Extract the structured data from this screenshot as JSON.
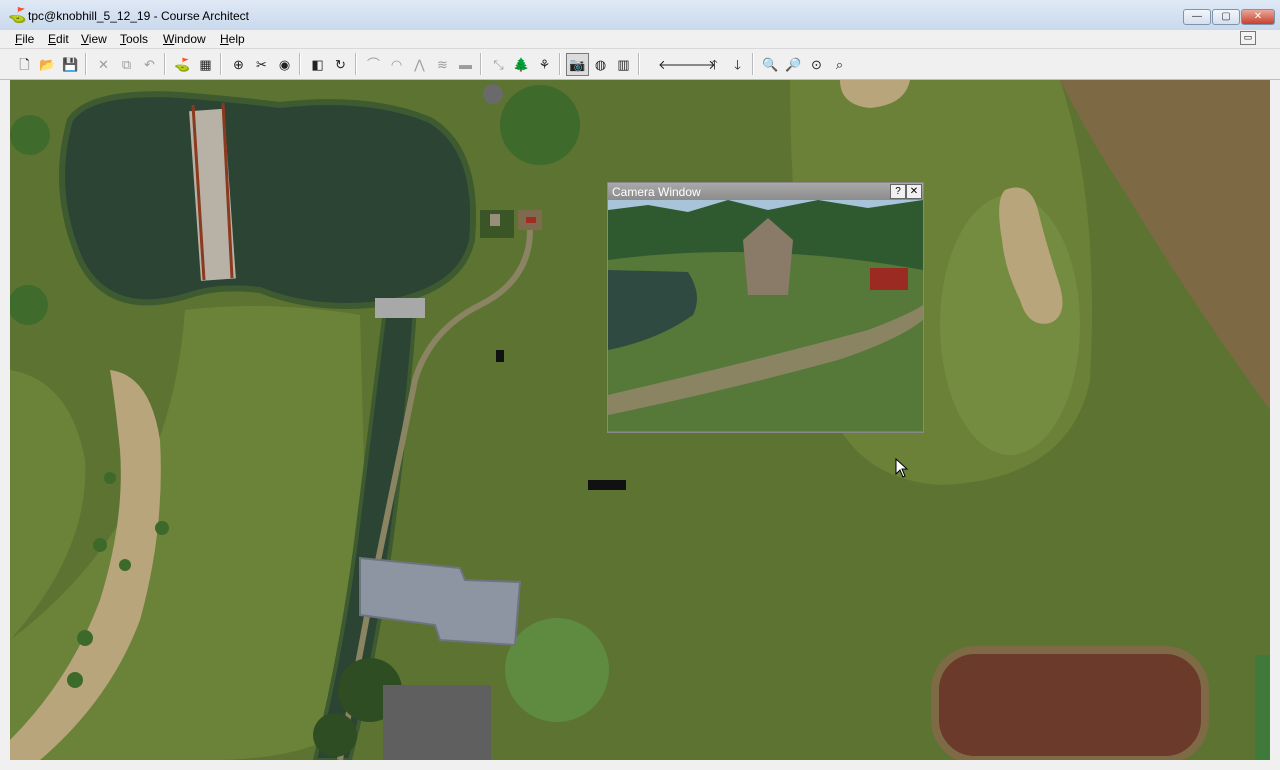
{
  "window": {
    "title": "tpc@knobhill_5_12_19 - Course Architect",
    "min_glyph": "—",
    "max_glyph": "▢",
    "close_glyph": "✕",
    "app_icon": "golf-flag-icon"
  },
  "menu": {
    "items": [
      "File",
      "Edit",
      "View",
      "Tools",
      "Window",
      "Help"
    ],
    "mdi_restore_glyph": "▭"
  },
  "toolbar": {
    "groups": [
      [
        {
          "icon": "new-file-icon",
          "glyph": "🗋"
        },
        {
          "icon": "open-folder-icon",
          "glyph": "📂"
        },
        {
          "icon": "save-icon",
          "glyph": "💾"
        }
      ],
      [
        {
          "icon": "delete-icon",
          "glyph": "✕",
          "dim": true
        },
        {
          "icon": "group-icon",
          "glyph": "⧉",
          "dim": true
        },
        {
          "icon": "undo-icon",
          "glyph": "↶",
          "dim": true
        }
      ],
      [
        {
          "icon": "hole-layout-icon",
          "glyph": "⛳",
          "dim": true
        },
        {
          "icon": "grid-icon",
          "glyph": "▦"
        }
      ],
      [
        {
          "icon": "select-target-icon",
          "glyph": "⊕"
        },
        {
          "icon": "spline-tool-icon",
          "glyph": "✂"
        },
        {
          "icon": "compass-icon",
          "glyph": "◉"
        }
      ],
      [
        {
          "icon": "measure-icon",
          "glyph": "◧"
        },
        {
          "icon": "rotate-icon",
          "glyph": "↻"
        }
      ],
      [
        {
          "icon": "terrain-raise-icon",
          "glyph": "⌒",
          "dim": true
        },
        {
          "icon": "terrain-round-icon",
          "glyph": "◠",
          "dim": true
        },
        {
          "icon": "terrain-peak-icon",
          "glyph": "⋀",
          "dim": true
        },
        {
          "icon": "terrain-ridge-icon",
          "glyph": "≋",
          "dim": true
        },
        {
          "icon": "terrain-flatten-icon",
          "glyph": "▬",
          "dim": true
        }
      ],
      [
        {
          "icon": "object-place-icon",
          "glyph": "⤡",
          "dim": true
        },
        {
          "icon": "tree-icon",
          "glyph": "🌲"
        },
        {
          "icon": "plant-tool-icon",
          "glyph": "⚘"
        }
      ],
      [
        {
          "icon": "camera-icon",
          "glyph": "📷",
          "pressed": true
        },
        {
          "icon": "globe-view-icon",
          "glyph": "◍"
        },
        {
          "icon": "columns-icon",
          "glyph": "▥"
        }
      ],
      [
        {
          "icon": "arrow-left-icon",
          "glyph": "🡐"
        },
        {
          "icon": "arrow-right-icon",
          "glyph": "🡒"
        },
        {
          "icon": "arrow-up-icon",
          "glyph": "🡑"
        },
        {
          "icon": "arrow-down-icon",
          "glyph": "🡓"
        }
      ],
      [
        {
          "icon": "zoom-in-icon",
          "glyph": "🔍"
        },
        {
          "icon": "zoom-out-icon",
          "glyph": "🔎"
        },
        {
          "icon": "zoom-fit-icon",
          "glyph": "⊙"
        },
        {
          "icon": "zoom-select-icon",
          "glyph": "⌕"
        }
      ]
    ]
  },
  "camera_window": {
    "title": "Camera Window",
    "help_glyph": "?",
    "close_glyph": "✕"
  },
  "colors": {
    "rough": "#5d7331",
    "fairway": "#6b8339",
    "water": "#2c4433",
    "sand": "#b9a57c",
    "outbounds": "#7d6a45",
    "dirt": "#6b3a2a",
    "path": "#8a8463",
    "building_roof": "#8d95a3"
  }
}
